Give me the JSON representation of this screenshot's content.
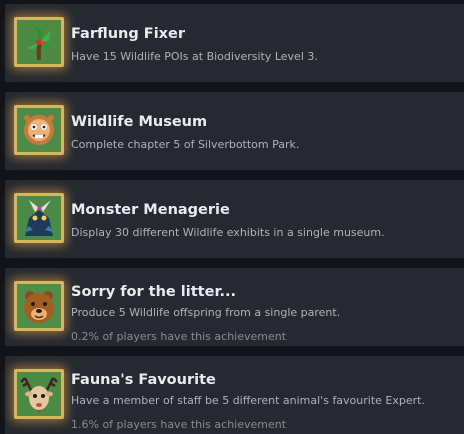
{
  "achievements": [
    {
      "title": "Farflung Fixer",
      "description": "Have 15 Wildlife POIs at Biodiversity Level 3.",
      "percent_text": "",
      "icon": "palm-tree-icon"
    },
    {
      "title": "Wildlife Museum",
      "description": "Complete chapter 5 of Silverbottom Park.",
      "percent_text": "",
      "icon": "lion-head-icon"
    },
    {
      "title": "Monster Menagerie",
      "description": "Display 30 different Wildlife exhibits in a single museum.",
      "percent_text": "",
      "icon": "horned-creature-icon"
    },
    {
      "title": "Sorry for the litter...",
      "description": "Produce 5 Wildlife offspring from a single parent.",
      "percent_text": "0.2% of players have this achievement",
      "icon": "bear-icon"
    },
    {
      "title": "Fauna's Favourite",
      "description": "Have a member of staff be 5 different animal's favourite Expert.",
      "percent_text": "1.6% of players have this achievement",
      "icon": "deer-icon"
    }
  ],
  "colors": {
    "background": "#121419",
    "card": "#262931",
    "frame_gold": "#d8b75a",
    "title": "#e9ebee",
    "description": "#aeb3ba",
    "percent": "#868b92"
  }
}
